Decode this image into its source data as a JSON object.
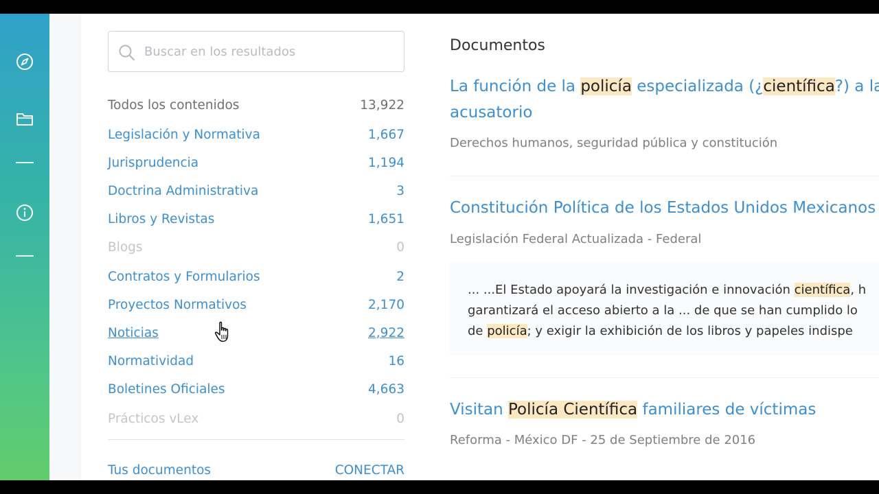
{
  "rail": {
    "icons": [
      "compass-icon",
      "folder-icon",
      "info-icon"
    ]
  },
  "search": {
    "placeholder": "Buscar en los resultados"
  },
  "facets": [
    {
      "label": "Todos los contenidos",
      "count": "13,922",
      "state": "all"
    },
    {
      "label": "Legislación y Normativa",
      "count": "1,667",
      "state": "link"
    },
    {
      "label": "Jurisprudencia",
      "count": "1,194",
      "state": "link"
    },
    {
      "label": "Doctrina Administrativa",
      "count": "3",
      "state": "link"
    },
    {
      "label": "Libros y Revistas",
      "count": "1,651",
      "state": "link"
    },
    {
      "label": "Blogs",
      "count": "0",
      "state": "disabled"
    },
    {
      "label": "Contratos y Formularios",
      "count": "2",
      "state": "link"
    },
    {
      "label": "Proyectos Normativos",
      "count": "2,170",
      "state": "link"
    },
    {
      "label": "Noticias",
      "count": "2,922",
      "state": "hover"
    },
    {
      "label": "Normatividad",
      "count": "16",
      "state": "link"
    },
    {
      "label": "Boletines Oficiales",
      "count": "4,663",
      "state": "link"
    },
    {
      "label": "Prácticos vLex",
      "count": "0",
      "state": "disabled"
    }
  ],
  "my_docs": {
    "label": "Tus documentos",
    "action": "CONECTAR"
  },
  "results": {
    "heading": "Documentos",
    "items": [
      {
        "title_line1": {
          "t1": "La función de la ",
          "h1": "policía",
          "t2": " especializada (¿",
          "h2": "científica",
          "t3": "?) a la"
        },
        "title_line2": "acusatorio",
        "meta": "Derechos humanos, seguridad pública y constitución"
      },
      {
        "title": "Constitución Política de los Estados Unidos Mexicanos",
        "meta": "Legislación Federal Actualizada - Federal",
        "snippet": {
          "l1a": "... ...El Estado apoyará la investigación e innovación ",
          "l1h": "científica",
          "l1b": ", h",
          "l2": "garantizará el acceso abierto a la ... de que se han cumplido lo",
          "l3a": "de ",
          "l3h": "policía",
          "l3b": "; y exigir la exhibición de los libros y papeles indispe"
        }
      },
      {
        "title": {
          "t1": "Visitan ",
          "h1": "Policía Científica",
          "t2": " familiares de víctimas"
        },
        "meta": "Reforma - México DF - 25 de Septiembre de 2016"
      }
    ]
  },
  "colors": {
    "link": "#3d8fcf",
    "highlight": "#fde8c4",
    "rail_top": "#2fa1c9",
    "rail_bottom": "#62cc6c"
  }
}
